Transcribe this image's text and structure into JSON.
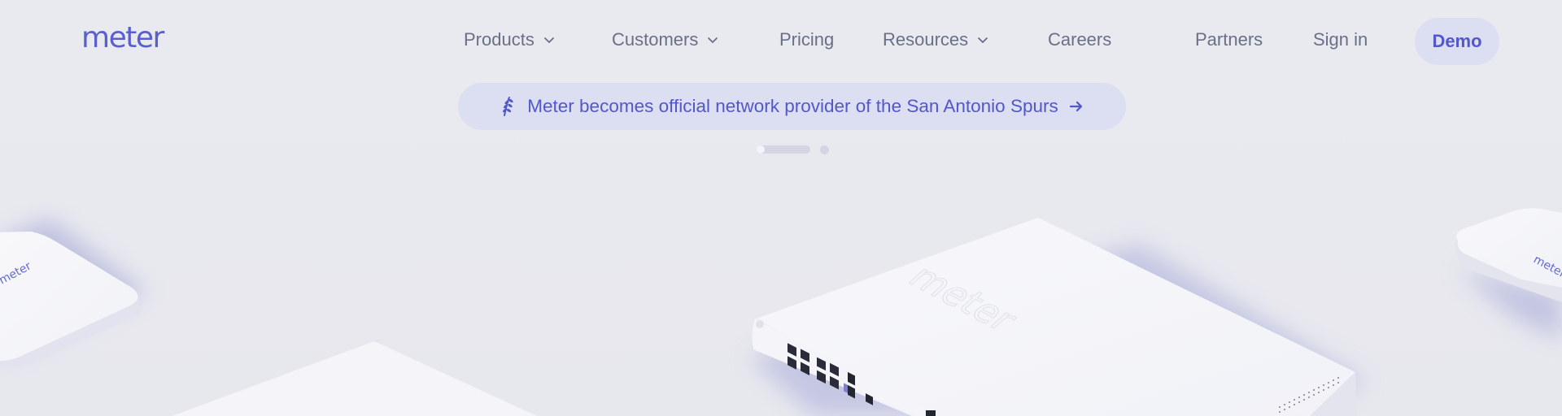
{
  "brand": {
    "logo_text": "meter",
    "accent_color": "#5a5fce"
  },
  "nav": {
    "items": [
      {
        "label": "Products",
        "has_dropdown": true
      },
      {
        "label": "Customers",
        "has_dropdown": true
      },
      {
        "label": "Pricing",
        "has_dropdown": false
      },
      {
        "label": "Resources",
        "has_dropdown": true
      },
      {
        "label": "Careers",
        "has_dropdown": false
      }
    ],
    "partners_label": "Partners",
    "signin_label": "Sign in",
    "demo_label": "Demo",
    "chevron_icon": "chevron-down-icon"
  },
  "announcement": {
    "icon": "basketball-laurel-icon",
    "text": "Meter becomes official network provider of the San Antonio Spurs",
    "arrow_icon": "arrow-right-icon"
  },
  "carousel": {
    "slide_count": 2,
    "active_index": 0
  },
  "hero": {
    "device_brand_text": "meter",
    "colors": {
      "device_top": "#f6f6fa",
      "device_side": "#e4e5ee",
      "shadow": "#b4b8dc"
    }
  }
}
